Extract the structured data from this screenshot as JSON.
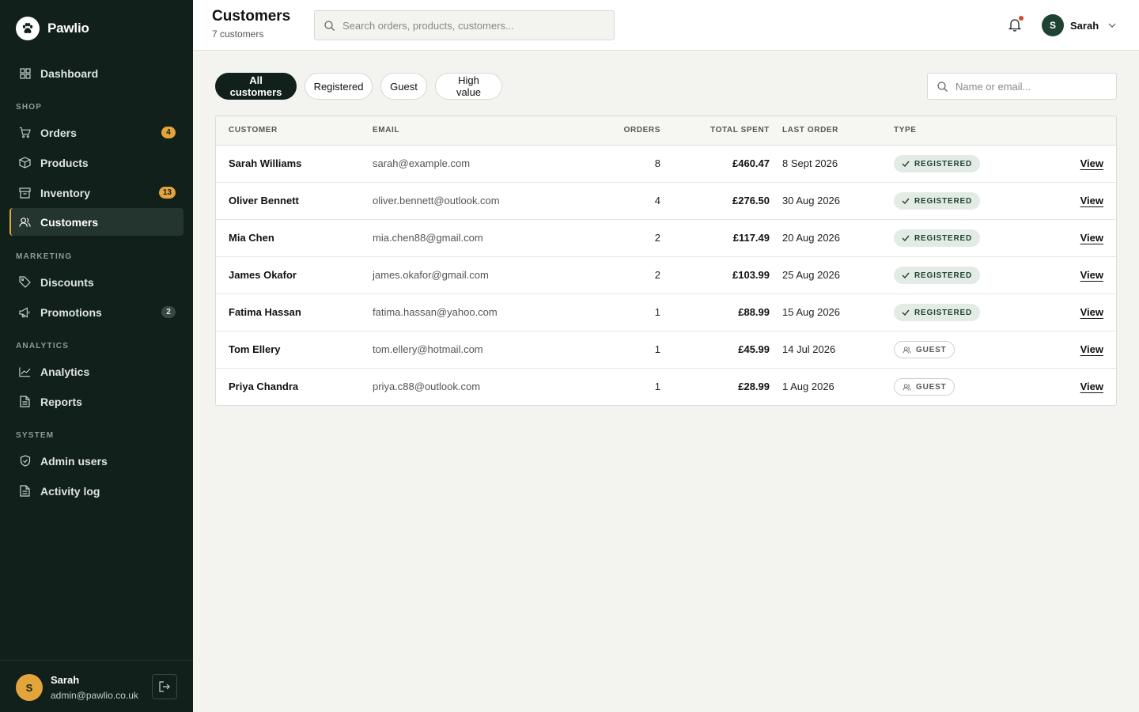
{
  "brand": {
    "name": "Pawlio"
  },
  "sidebar": {
    "dashboard": "Dashboard",
    "sections": {
      "shop": "SHOP",
      "marketing": "MARKETING",
      "analytics": "ANALYTICS",
      "system": "SYSTEM"
    },
    "items": {
      "orders": {
        "label": "Orders",
        "badge": "4"
      },
      "products": {
        "label": "Products"
      },
      "inventory": {
        "label": "Inventory",
        "badge": "13"
      },
      "customers": {
        "label": "Customers"
      },
      "discounts": {
        "label": "Discounts"
      },
      "promotions": {
        "label": "Promotions",
        "badge": "2"
      },
      "analytics": {
        "label": "Analytics"
      },
      "reports": {
        "label": "Reports"
      },
      "admin_users": {
        "label": "Admin users"
      },
      "activity_log": {
        "label": "Activity log"
      }
    },
    "footer": {
      "initial": "S",
      "name": "Sarah",
      "email": "admin@pawlio.co.uk"
    }
  },
  "header": {
    "title": "Customers",
    "subtitle": "7 customers",
    "search_placeholder": "Search orders, products, customers...",
    "user": {
      "initial": "S",
      "name": "Sarah"
    }
  },
  "filters": {
    "chips": [
      "All customers",
      "Registered",
      "Guest",
      "High value"
    ],
    "search_placeholder": "Name or email..."
  },
  "table": {
    "columns": {
      "customer": "CUSTOMER",
      "email": "EMAIL",
      "orders": "ORDERS",
      "total": "TOTAL SPENT",
      "last": "LAST ORDER",
      "type": "TYPE"
    },
    "view_label": "View",
    "rows": [
      {
        "name": "Sarah Williams",
        "email": "sarah@example.com",
        "orders": "8",
        "total": "£460.47",
        "last": "8 Sept 2026",
        "type": "REGISTERED"
      },
      {
        "name": "Oliver Bennett",
        "email": "oliver.bennett@outlook.com",
        "orders": "4",
        "total": "£276.50",
        "last": "30 Aug 2026",
        "type": "REGISTERED"
      },
      {
        "name": "Mia Chen",
        "email": "mia.chen88@gmail.com",
        "orders": "2",
        "total": "£117.49",
        "last": "20 Aug 2026",
        "type": "REGISTERED"
      },
      {
        "name": "James Okafor",
        "email": "james.okafor@gmail.com",
        "orders": "2",
        "total": "£103.99",
        "last": "25 Aug 2026",
        "type": "REGISTERED"
      },
      {
        "name": "Fatima Hassan",
        "email": "fatima.hassan@yahoo.com",
        "orders": "1",
        "total": "£88.99",
        "last": "15 Aug 2026",
        "type": "REGISTERED"
      },
      {
        "name": "Tom Ellery",
        "email": "tom.ellery@hotmail.com",
        "orders": "1",
        "total": "£45.99",
        "last": "14 Jul 2026",
        "type": "GUEST"
      },
      {
        "name": "Priya Chandra",
        "email": "priya.c88@outlook.com",
        "orders": "1",
        "total": "£28.99",
        "last": "1 Aug 2026",
        "type": "GUEST"
      }
    ]
  },
  "colors": {
    "sidebar_bg": "#11201b",
    "accent": "#e3a43a",
    "brand_green": "#1f4333",
    "registered_bg": "#e3ebe5",
    "notification_dot": "#d9482b"
  }
}
